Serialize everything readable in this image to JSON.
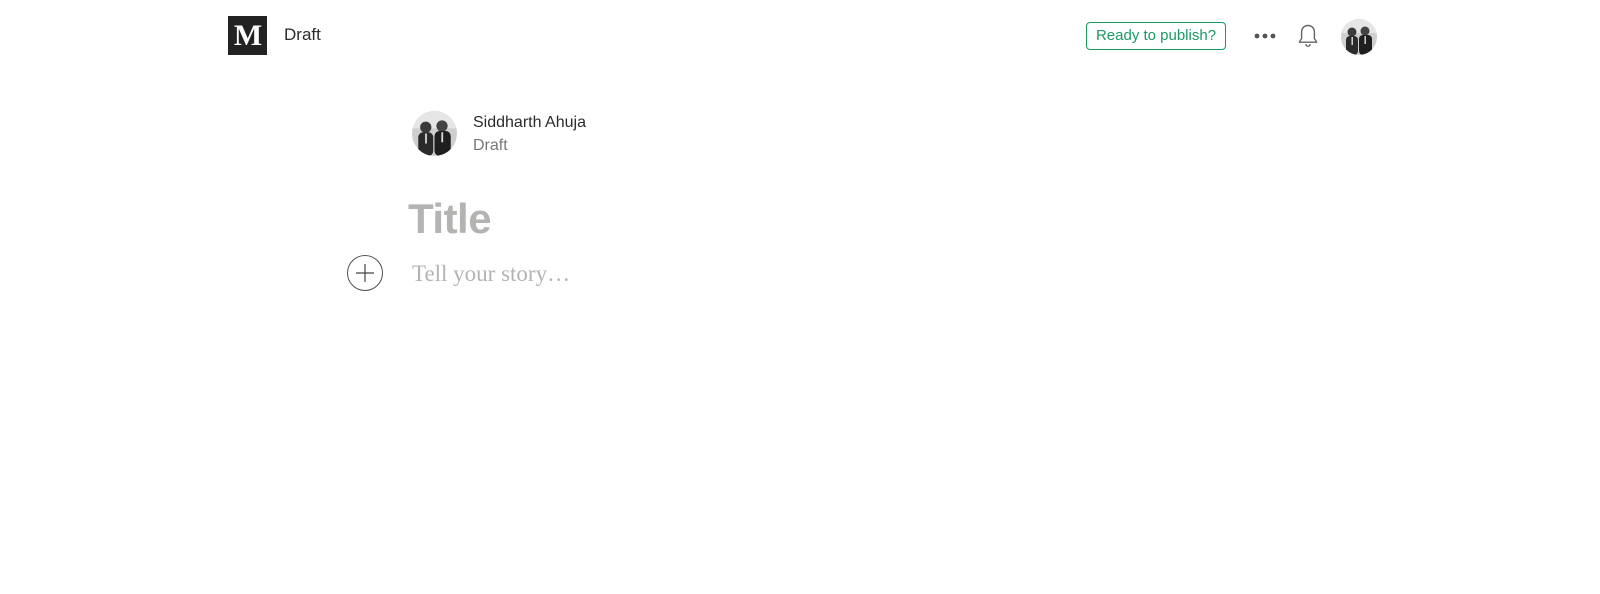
{
  "header": {
    "logo_text": "M",
    "status": "Draft",
    "publish_label": "Ready to publish?",
    "more_icon": "more-horizontal-icon",
    "notifications_icon": "bell-icon",
    "avatar_icon": "user-avatar"
  },
  "author": {
    "name": "Siddharth Ahuja",
    "status": "Draft"
  },
  "editor": {
    "title_placeholder": "Title",
    "body_placeholder": "Tell your story…",
    "add_icon": "plus-circle-icon"
  },
  "colors": {
    "accent": "#1c9963",
    "placeholder": "#b3b3b1",
    "logo_bg": "#222222"
  }
}
